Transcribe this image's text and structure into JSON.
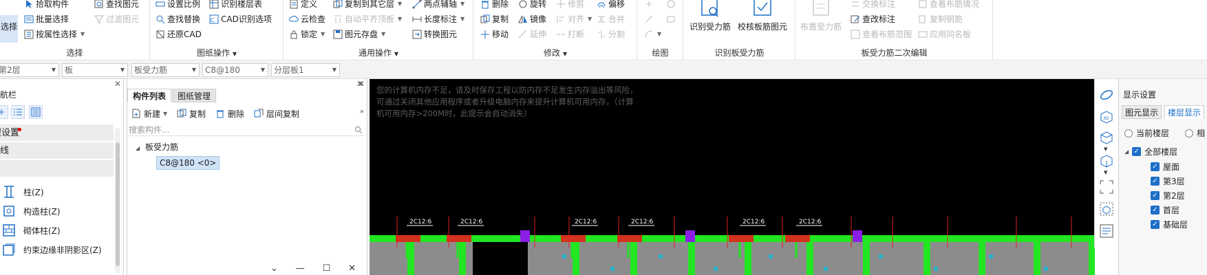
{
  "ribbon": {
    "select": {
      "big_label": "选择",
      "items": [
        "拾取构件",
        "批量选择",
        "按属性选择"
      ],
      "items_col2": [
        "查找图元",
        "过滤图元"
      ],
      "group_label": "选择"
    },
    "drawing_ops": {
      "items": [
        "设置比例",
        "查找替换",
        "还原CAD"
      ],
      "items_col2": [
        "识别楼层表",
        "CAD识别选项"
      ],
      "group_label": "图纸操作"
    },
    "general_ops": {
      "items": [
        "定义",
        "云检查",
        "锁定"
      ],
      "items_col2": [
        "复制到其它层",
        "自动平齐顶板",
        "图元存盘"
      ],
      "items_col3": [
        "两点辅轴",
        "长度标注",
        "转换图元"
      ],
      "group_label": "通用操作"
    },
    "modify": {
      "col1": [
        "删除",
        "复制",
        "移动"
      ],
      "col2": [
        "旋转",
        "镜像",
        "延伸"
      ],
      "col3": [
        "修剪",
        "对齐",
        "打断"
      ],
      "col4": [
        "偏移",
        "合并",
        "分割"
      ],
      "group_label": "修改"
    },
    "draw": {
      "group_label": "绘图"
    },
    "recognize_slab": {
      "big1": "识别受力筋",
      "big2": "校核板筋图元",
      "group_label": "识别板受力筋"
    },
    "secondary_edit": {
      "big": "布置受力筋",
      "col1": [
        "交换标注",
        "查改标注",
        "查看布筋范围"
      ],
      "col2": [
        "查看布筋情况",
        "复制钢筋",
        "应用同名板"
      ],
      "group_label": "板受力筋二次编辑"
    }
  },
  "filterbar": {
    "floor": "第2层",
    "category": "板",
    "type": "板受力筋",
    "spec": "C8@180",
    "layer": "分层板1"
  },
  "nav": {
    "title": "导航栏",
    "rows": [
      "工程设置",
      "轴线",
      "柱"
    ],
    "items": [
      "柱(Z)",
      "构造柱(Z)",
      "砌体柱(Z)",
      "约束边缘非阴影区(Z)"
    ]
  },
  "component_panel": {
    "tabs": [
      "构件列表",
      "图纸管理"
    ],
    "tools": [
      "新建",
      "复制",
      "删除",
      "层间复制"
    ],
    "search_placeholder": "搜索构件...",
    "tree_root": "板受力筋",
    "tree_leaf": "C8@180 <0>"
  },
  "canvas": {
    "warning": "您的计算机内存不足，请及时保存工程以防内存不足发生内存溢出等风险，可通过关闭其他应用程序或者升级电脑内存来提升计算机可用内存。（计算机可用内存>200M时，此提示会自动消失）",
    "rebar_labels": [
      "2C12:6",
      "2C12:6",
      "2C12:6",
      "2C12:6",
      "2C12:6",
      "2C12:6"
    ],
    "colors": {
      "background": "#000000",
      "beam": "#22e622",
      "slab": "#8c8c8c",
      "column": "#8a1ee6",
      "rebar": "#e61e1e"
    }
  },
  "display_settings": {
    "title": "显示设置",
    "tabs": [
      "图元显示",
      "楼层显示"
    ],
    "radio_current": "当前楼层",
    "radio_other": "相",
    "all_floors": "全部楼层",
    "floors": [
      "屋面",
      "第3层",
      "第2层",
      "首层",
      "基础层"
    ]
  },
  "window_controls": {
    "dropdown": "⌄",
    "minimize": "—",
    "maximize": "☐",
    "close": "✕"
  }
}
